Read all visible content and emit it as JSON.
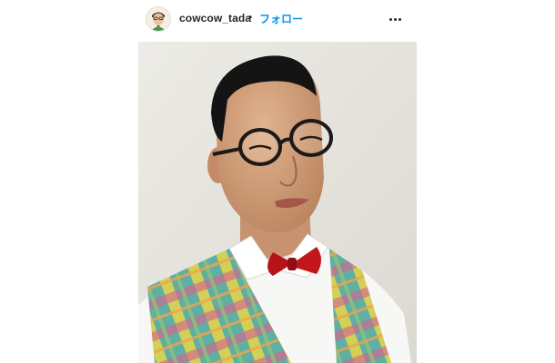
{
  "post": {
    "username": "cowcow_tada",
    "separator": "•",
    "follow_label": "フォロー",
    "more_icon": "more-horizontal-icon",
    "avatar_icon": "profile-avatar",
    "photo": {
      "subject": "portrait-photo",
      "colors": {
        "background": "#e9e6df",
        "vest_plaid": "#5fb0a3",
        "bow_tie": "#c0161c",
        "shirt": "#ffffff"
      }
    }
  }
}
